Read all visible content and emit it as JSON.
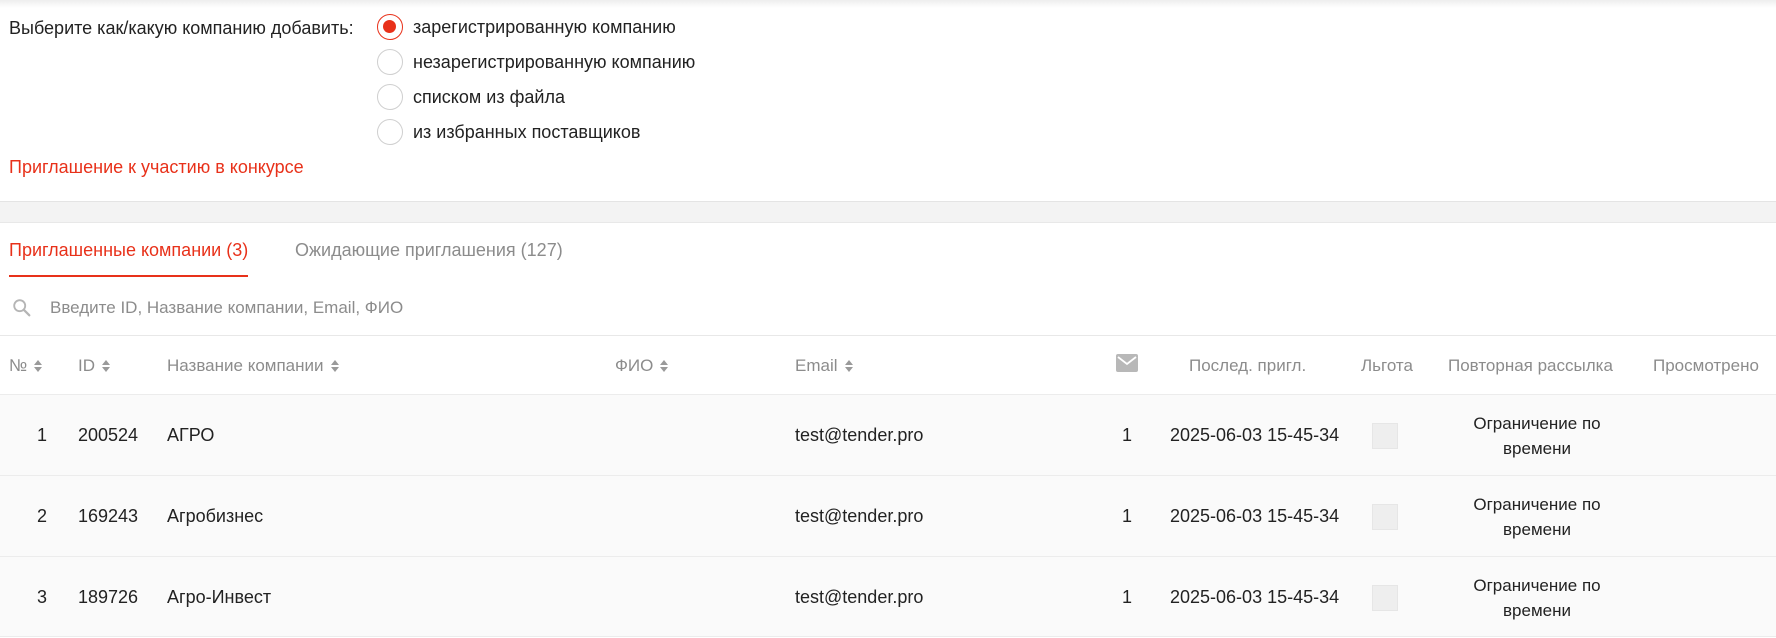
{
  "add_company": {
    "label": "Выберите как/какую компанию добавить:",
    "options": [
      {
        "label": "зарегистрированную компанию",
        "checked": true
      },
      {
        "label": "незарегистрированную компанию",
        "checked": false
      },
      {
        "label": "списком из файла",
        "checked": false
      },
      {
        "label": "из избранных поставщиков",
        "checked": false
      }
    ]
  },
  "invite_link": "Приглашение к участию в конкурсе",
  "tabs": [
    {
      "label": "Приглашенные компании (3)",
      "active": true
    },
    {
      "label": "Ожидающие приглашения (127)",
      "active": false
    }
  ],
  "search": {
    "placeholder": "Введите ID, Название компании, Email, ФИО",
    "value": "",
    "icon": "search-icon"
  },
  "table": {
    "columns": {
      "num": "№",
      "id": "ID",
      "company": "Название компании",
      "fio": "ФИО",
      "email": "Email",
      "sent_icon": "mail-icon",
      "last_invite": "Послед. пригл.",
      "benefit": "Льгота",
      "resend": "Повторная рассылка",
      "viewed": "Просмотрено"
    },
    "rows": [
      {
        "num": "1",
        "id": "200524",
        "company": "АГРО",
        "fio": "",
        "email": "test@tender.pro",
        "sent": "1",
        "last_invite": "2025-06-03 15-45-34",
        "resend": "Ограничение по времени",
        "viewed": ""
      },
      {
        "num": "2",
        "id": "169243",
        "company": "Агробизнес",
        "fio": "",
        "email": "test@tender.pro",
        "sent": "1",
        "last_invite": "2025-06-03 15-45-34",
        "resend": "Ограничение по времени",
        "viewed": ""
      },
      {
        "num": "3",
        "id": "189726",
        "company": "Агро-Инвест",
        "fio": "",
        "email": "test@tender.pro",
        "sent": "1",
        "last_invite": "2025-06-03 15-45-34",
        "resend": "Ограничение по времени",
        "viewed": ""
      }
    ]
  },
  "colors": {
    "accent": "#e8311a",
    "muted_text": "#8c8c8c",
    "row_background": "#fafafa"
  }
}
